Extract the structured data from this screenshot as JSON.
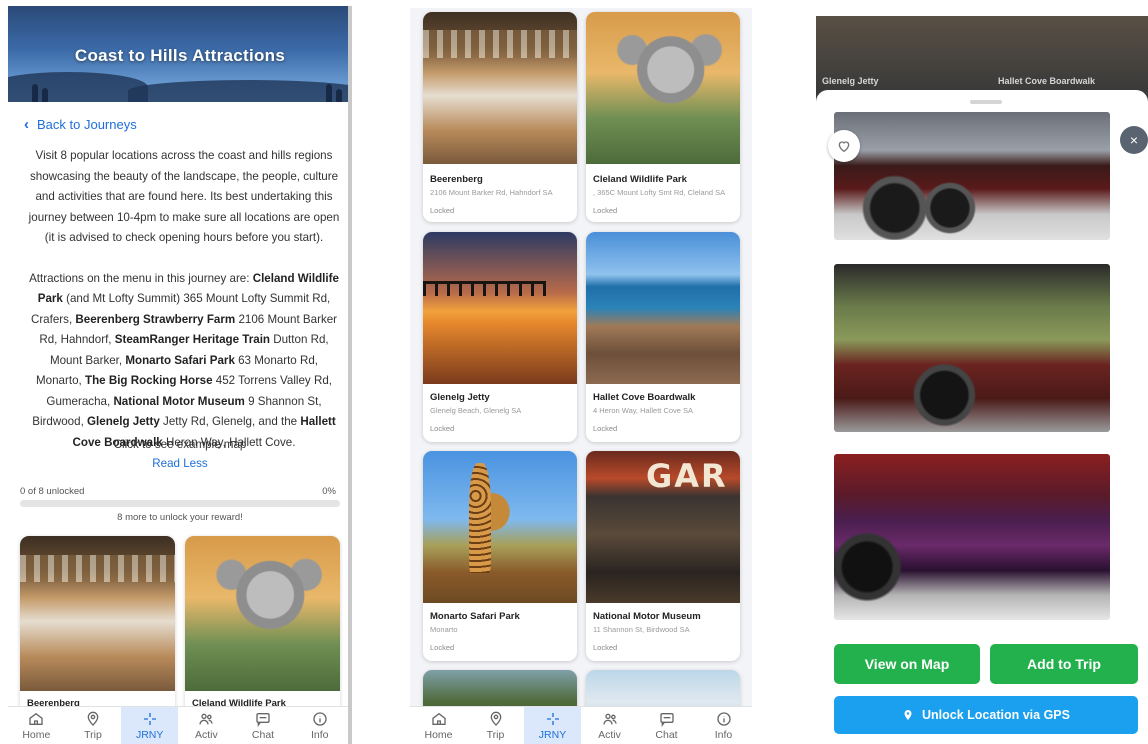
{
  "panel1": {
    "title": "Coast to Hills Attractions",
    "back_label": "Back to Journeys",
    "description_p1": "Visit 8 popular locations across the coast and hills regions showcasing the beauty of the landscape, the people, culture and activities that are found here. Its best undertaking this journey between 10-4pm to make sure all locations are open (it is advised to check opening hours before you start).",
    "desc2": {
      "intro": "Attractions on the menu in this journey are: ",
      "a1": "Cleland Wildlife Park",
      "t1": " (and Mt Lofty Summit) 365 Mount Lofty Summit Rd, Crafers, ",
      "a2": "Beerenberg Strawberry Farm",
      "t2": " 2106 Mount Barker Rd, Hahndorf, ",
      "a3": "SteamRanger Heritage Train",
      "t3": " Dutton Rd, Mount Barker, ",
      "a4": "Monarto Safari Park",
      "t4": " 63 Monarto Rd, Monarto, ",
      "a5": "The Big Rocking Horse",
      "t5": " 452 Torrens Valley Rd, Gumeracha, ",
      "a6": "National Motor Museum",
      "t6": " 9 Shannon St, Birdwood, ",
      "a7": "Glenelg Jetty",
      "t7": " Jetty Rd, Glenelg, and the ",
      "a8": "Hallett Cove Boardwalk",
      "t8": " Heron Way, Hallett Cove."
    },
    "map_link": "Click to see example map",
    "read_less": "Read Less",
    "progress_label": "0 of 8 unlocked",
    "progress_percent_label": "0%",
    "progress_fraction": 0,
    "progress_message": "8 more to unlock your reward!",
    "cards": [
      {
        "title": "Beerenberg"
      },
      {
        "title": "Cleland Wildlife Park"
      }
    ]
  },
  "panel2": {
    "cards": [
      {
        "title": "Beerenberg",
        "address": "2106 Mount Barker Rd, Hahndorf SA",
        "status": "Locked"
      },
      {
        "title": "Cleland Wildlife Park",
        "address": ", 365C Mount Lofty Smt Rd, Cleland SA",
        "status": "Locked"
      },
      {
        "title": "Glenelg Jetty",
        "address": "Glenelg Beach, Glenelg SA",
        "status": "Locked"
      },
      {
        "title": "Hallet Cove Boardwalk",
        "address": "4 Heron Way, Hallett Cove SA",
        "status": "Locked"
      },
      {
        "title": "Monarto Safari Park",
        "address": "Monarto",
        "status": "Locked"
      },
      {
        "title": "National Motor Museum",
        "address": "11 Shannon St, Birdwood SA",
        "status": "Locked"
      }
    ]
  },
  "panel3": {
    "bg_labels": [
      "Glenelg Jetty",
      "Hallet Cove Boardwalk"
    ],
    "view_on_map": "View on Map",
    "add_to_trip": "Add to Trip",
    "unlock_gps": "Unlock Location via GPS",
    "close_glyph": "×"
  },
  "nav": [
    {
      "label": "Home",
      "icon": "home-icon"
    },
    {
      "label": "Trip",
      "icon": "map-pin-icon"
    },
    {
      "label": "JRNY",
      "icon": "sparkle-icon"
    },
    {
      "label": "Activ",
      "icon": "users-icon"
    },
    {
      "label": "Chat",
      "icon": "chat-icon"
    },
    {
      "label": "Info",
      "icon": "info-icon"
    }
  ],
  "colors": {
    "accent": "#1e6fd9",
    "green": "#22b14c",
    "gps_blue": "#1aa0ef",
    "nav_active_bg": "#dbe8fb"
  }
}
